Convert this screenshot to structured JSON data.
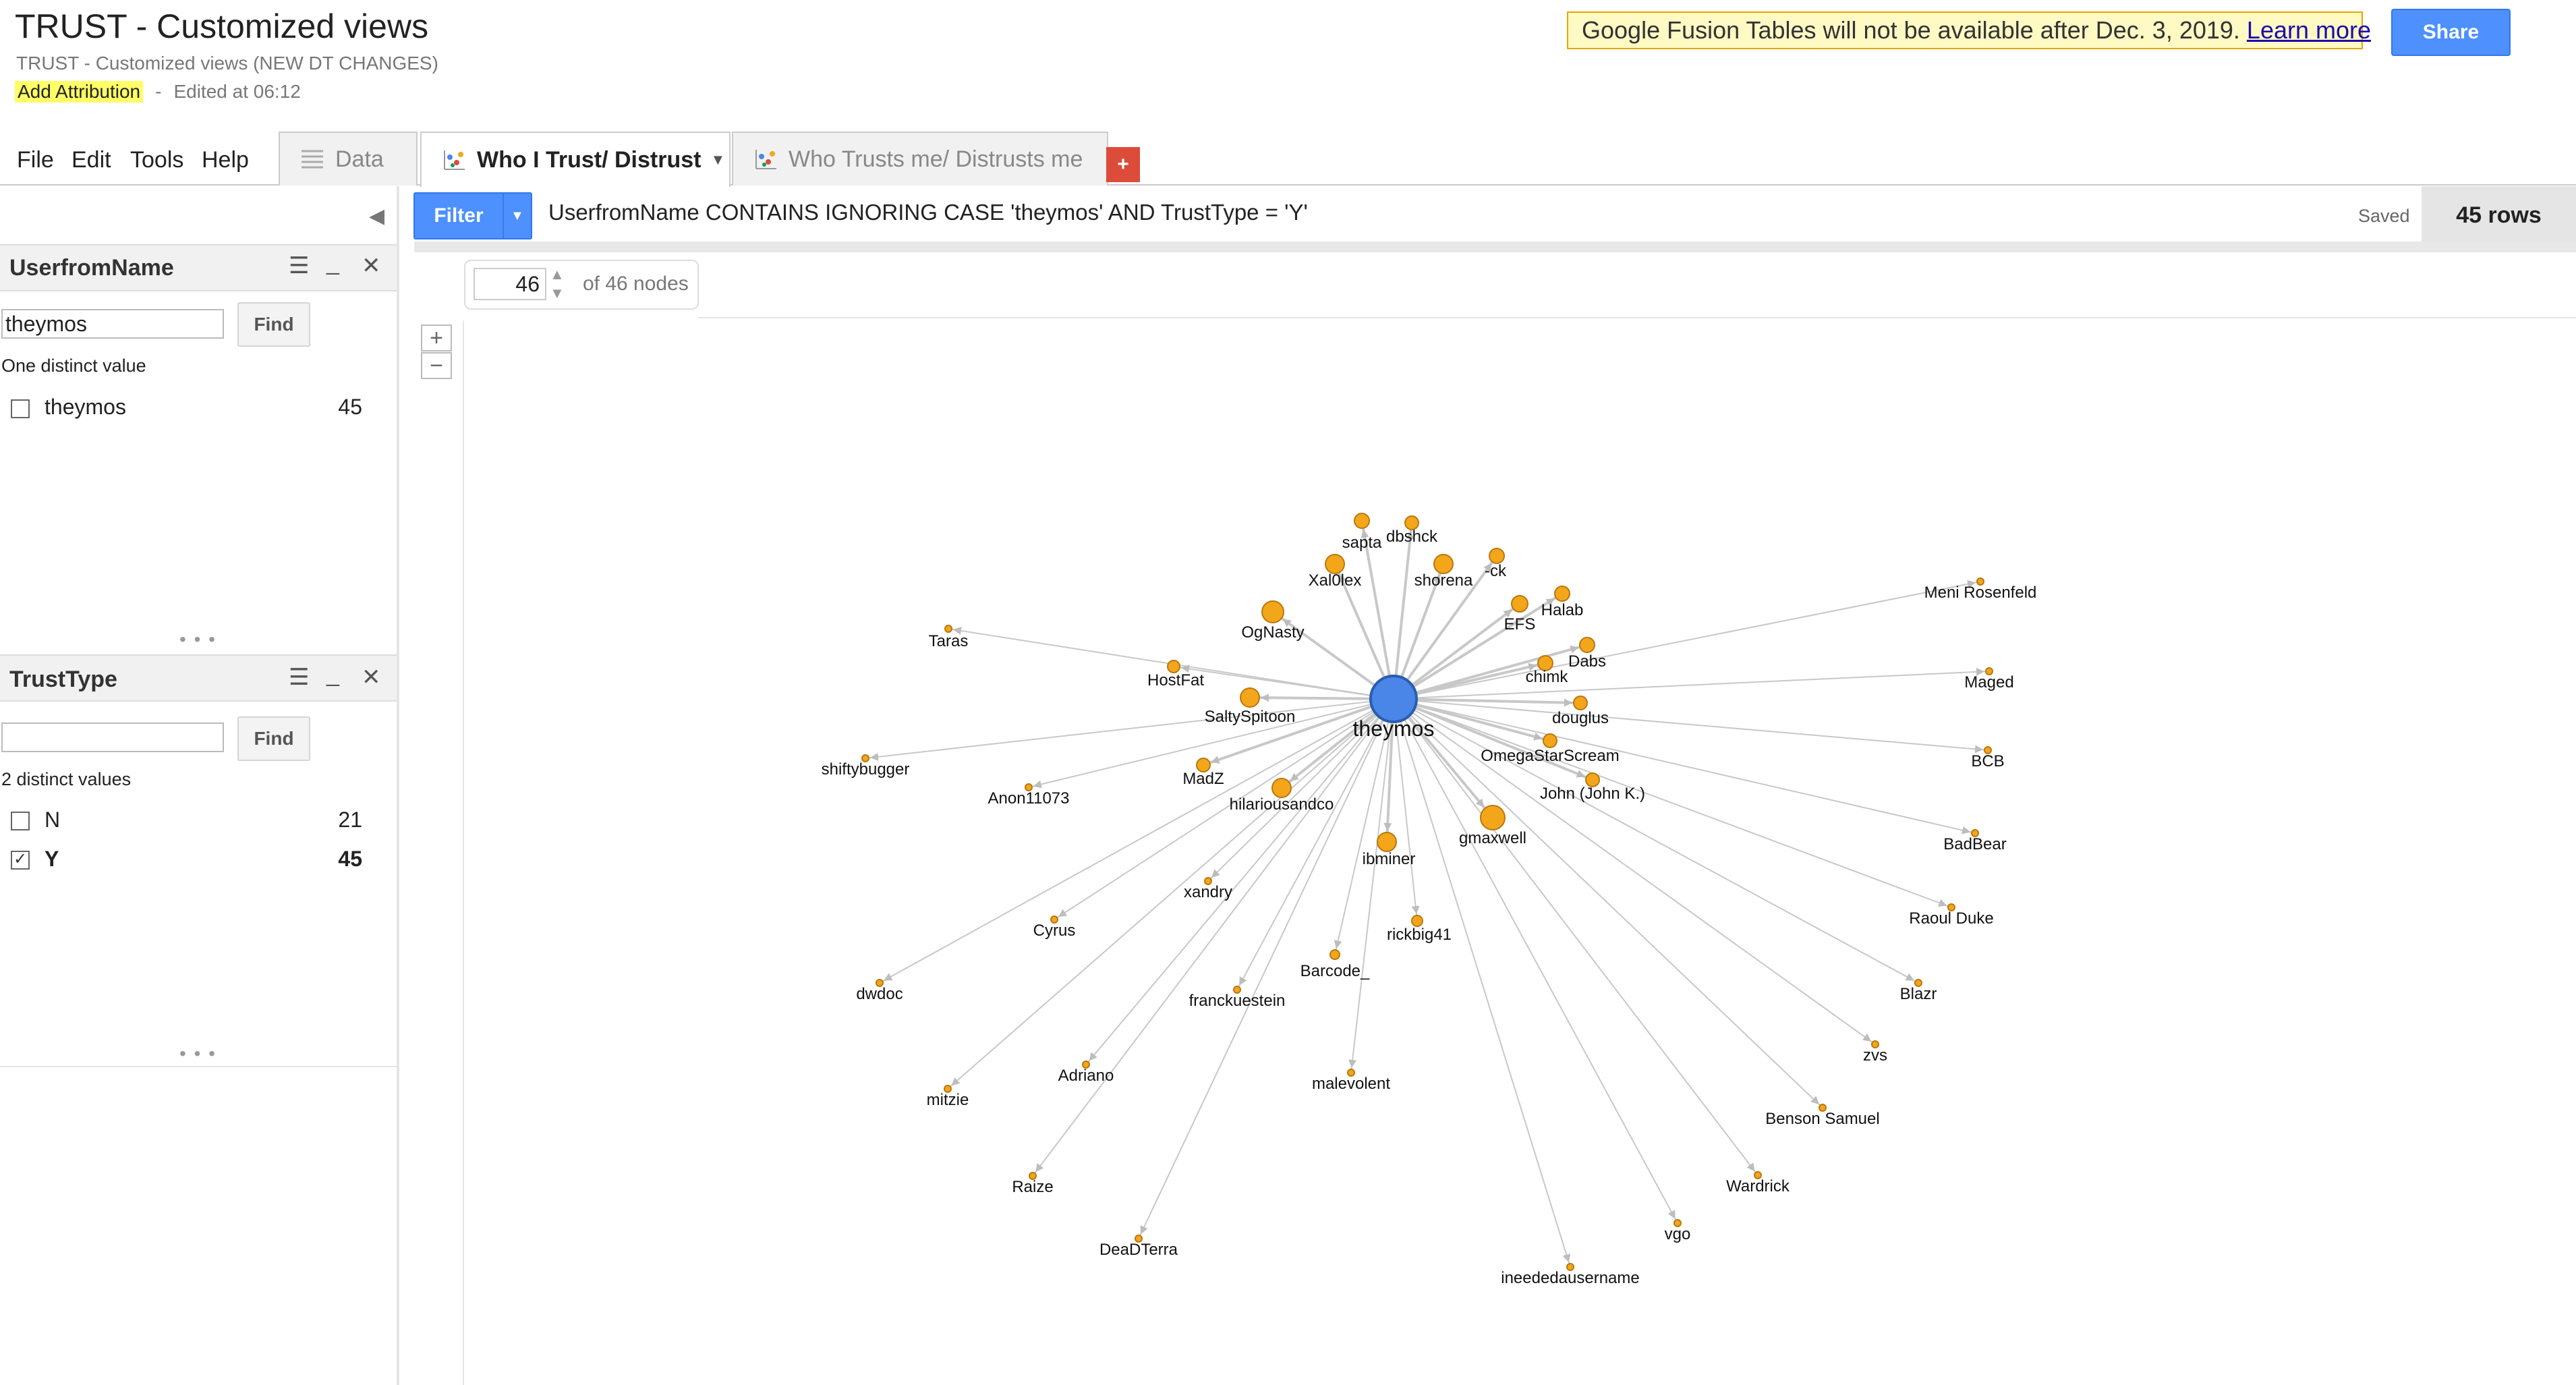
{
  "header": {
    "title": "TRUST - Customized views",
    "subtitle": "TRUST - Customized views (NEW DT CHANGES)",
    "add_attribution": "Add Attribution",
    "separator": "-",
    "edited": "Edited at 06:12",
    "notice_text": "Google Fusion Tables will not be available after Dec. 3, 2019.",
    "notice_link": "Learn more",
    "share_label": "Share"
  },
  "menu": [
    "File",
    "Edit",
    "Tools",
    "Help"
  ],
  "tabs": [
    {
      "label": "Data",
      "icon": "table-icon",
      "active": false
    },
    {
      "label": "Who I Trust/ Distrust",
      "icon": "network-graph-icon",
      "active": true
    },
    {
      "label": "Who Trusts me/ Distrusts me",
      "icon": "network-graph-icon",
      "active": false
    }
  ],
  "add_tab_label": "+",
  "left_panel": {
    "collapse_icon": "collapse-left-icon",
    "filters": [
      {
        "title": "UserfromName",
        "input_value": "theymos",
        "find_label": "Find",
        "summary": "One distinct value",
        "values": [
          {
            "label": "theymos",
            "count": "45",
            "checked": false
          }
        ]
      },
      {
        "title": "TrustType",
        "input_value": "",
        "find_label": "Find",
        "summary": "2 distinct values",
        "values": [
          {
            "label": "N",
            "count": "21",
            "checked": false
          },
          {
            "label": "Y",
            "count": "45",
            "checked": true
          }
        ]
      }
    ]
  },
  "filter_bar": {
    "button_label": "Filter",
    "query": "UserfromName CONTAINS IGNORING CASE 'theymos' AND TrustType = 'Y'",
    "saved": "Saved",
    "rows": "45 rows"
  },
  "graph_controls": {
    "node_count": "46",
    "of_nodes": "of 46 nodes",
    "zoom_in": "+",
    "zoom_out": "−"
  },
  "graph": {
    "center": {
      "label": "theymos",
      "color": "#4a86e8"
    },
    "node_color": "#f4a61a",
    "nodes": [
      "sapta",
      "dbshck",
      "Xal0lex",
      "shorena",
      "-ck",
      "OgNasty",
      "EFS",
      "Halab",
      "Taras",
      "Dabs",
      "HostFat",
      "chimk",
      "SaltySpitoon",
      "douglus",
      "shiftybugger",
      "MadZ",
      "OmegaStarScream",
      "Anon11073",
      "hilariousandco",
      "John (John K.)",
      "gmaxwell",
      "ibminer",
      "xandry",
      "Cyrus",
      "rickbig41",
      "dwdoc",
      "Barcode_",
      "franckuestein",
      "mitzie",
      "Adriano",
      "malevolent",
      "Raize",
      "DeaDTerra",
      "ineededausername",
      "vgo",
      "Wardrick",
      "Benson Samuel",
      "zvs",
      "Blazr",
      "Raoul Duke",
      "BadBear",
      "BCB",
      "Maged",
      "Meni Rosenfeld"
    ]
  }
}
